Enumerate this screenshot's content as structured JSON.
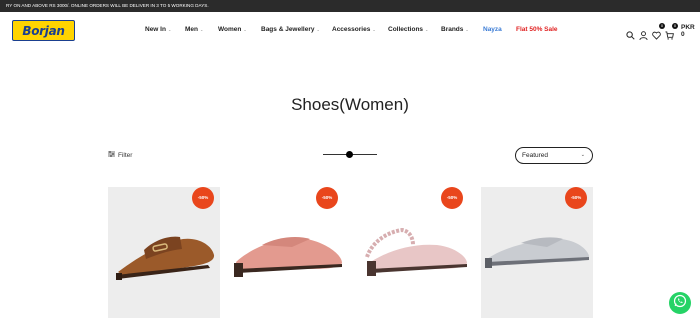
{
  "announcement": "RY ON AND ABOVE RS 3000/. ONLINE ORDERS WILL BE DELIVER IN 3 TO 5 WORKING DAYS.",
  "logo_text": "Borjan",
  "nav": [
    {
      "label": "New In",
      "has_menu": true
    },
    {
      "label": "Men",
      "has_menu": true
    },
    {
      "label": "Women",
      "has_menu": true
    },
    {
      "label": "Bags & Jewellery",
      "has_menu": true
    },
    {
      "label": "Accessories",
      "has_menu": true
    },
    {
      "label": "Collections",
      "has_menu": true
    },
    {
      "label": "Brands",
      "has_menu": true
    },
    {
      "label": "Nayza",
      "has_menu": false,
      "color": "#3a7bd5"
    },
    {
      "label": "Flat 50% Sale",
      "has_menu": false,
      "color": "#e02020"
    }
  ],
  "header_icons": {
    "wishlist_count": "0",
    "cart_count": "0",
    "cart_total": "PKR 0"
  },
  "page_title": "Shoes(Women)",
  "toolbar": {
    "filter_label": "Filter",
    "sort_selected": "Featured"
  },
  "products": [
    {
      "badge": "-50%",
      "shoe_color": "#9b5a2a",
      "background": "#ededed"
    },
    {
      "badge": "-50%",
      "shoe_color": "#e39a8f",
      "background": "#ffffff"
    },
    {
      "badge": "-50%",
      "shoe_color": "#e8c6c6",
      "background": "#ffffff"
    },
    {
      "badge": "-50%",
      "shoe_color": "#c9ccd1",
      "background": "#ededed"
    }
  ],
  "colors": {
    "sale_badge": "#e9461c",
    "whatsapp": "#25d366",
    "logo_bg": "#ffd400",
    "logo_text": "#1a3f8f"
  }
}
